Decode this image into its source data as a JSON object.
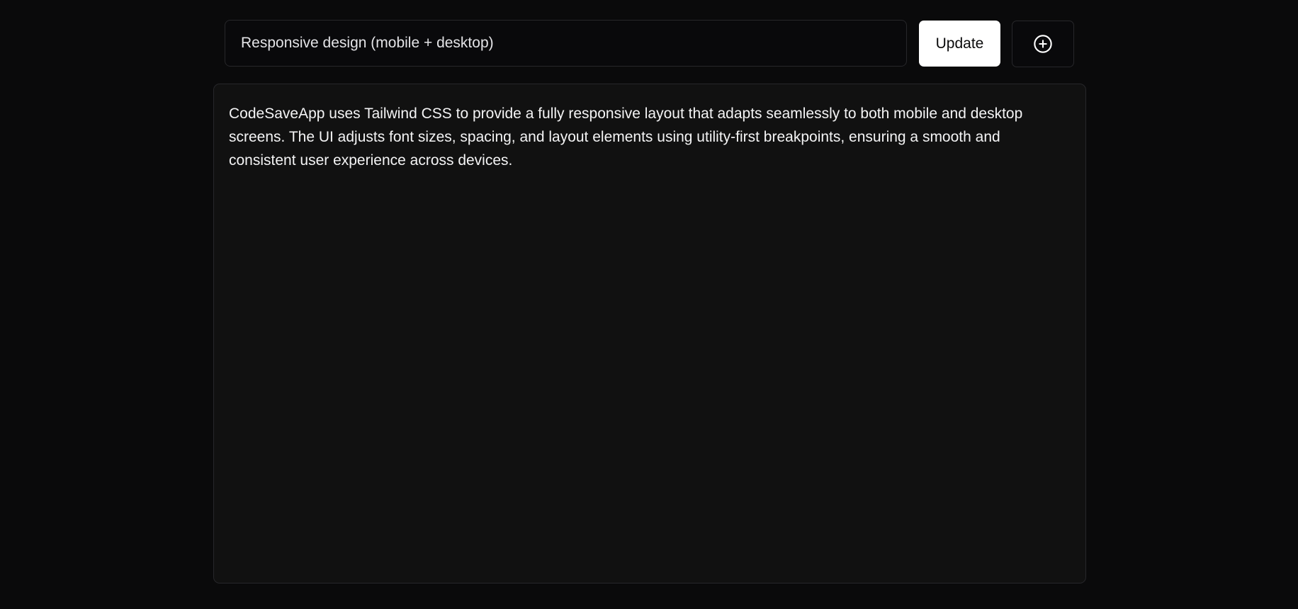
{
  "editor": {
    "title_value": "Responsive design (mobile + desktop)",
    "update_label": "Update",
    "new_icon": "plus-circle-icon",
    "body_text": "CodeSaveApp uses Tailwind CSS to provide a fully responsive layout that adapts seamlessly to both mobile and desktop screens. The UI adjusts font sizes, spacing, and layout elements using utility-first breakpoints, ensuring a smooth and consistent user experience across devices."
  },
  "colors": {
    "background": "#0a0a0b",
    "panel": "#111111",
    "border": "#27272a",
    "primary_button": "#ffffff"
  }
}
